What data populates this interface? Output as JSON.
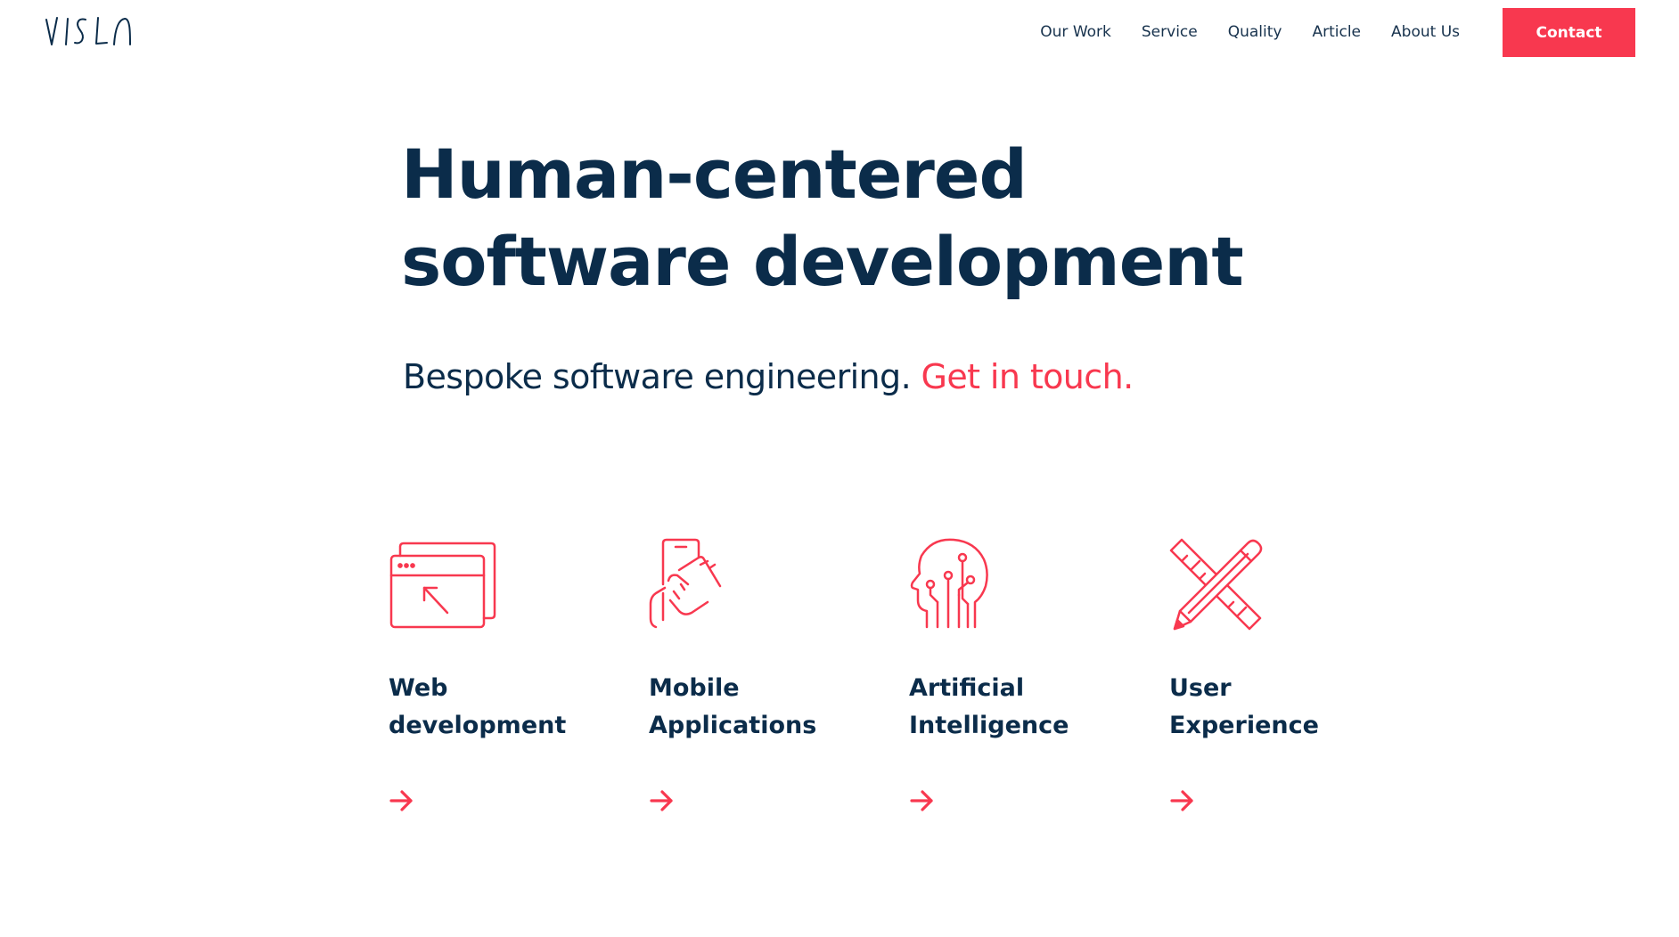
{
  "brand": {
    "logo_text": "VISLA",
    "accent_color": "#f8384f",
    "text_color": "#0b2c4a"
  },
  "nav": {
    "items": [
      {
        "label": "Our Work"
      },
      {
        "label": "Service"
      },
      {
        "label": "Quality"
      },
      {
        "label": "Article"
      },
      {
        "label": "About Us"
      }
    ],
    "contact_label": "Contact"
  },
  "hero": {
    "title_line1": "Human-centered",
    "title_line2": "software development",
    "subtitle": "Bespoke software engineering.",
    "subtitle_link": "Get in touch."
  },
  "services": [
    {
      "title_line1": "Web",
      "title_line2": "development",
      "icon": "browser-cursor-icon",
      "arrow_icon": "arrow-right-icon"
    },
    {
      "title_line1": "Mobile",
      "title_line2": "Applications",
      "icon": "phone-touch-icon",
      "arrow_icon": "arrow-right-icon"
    },
    {
      "title_line1": "Artificial",
      "title_line2": "Intelligence",
      "icon": "circuit-head-icon",
      "arrow_icon": "arrow-right-icon"
    },
    {
      "title_line1": "User",
      "title_line2": "Experience",
      "icon": "pencil-ruler-icon",
      "arrow_icon": "arrow-right-icon"
    }
  ]
}
